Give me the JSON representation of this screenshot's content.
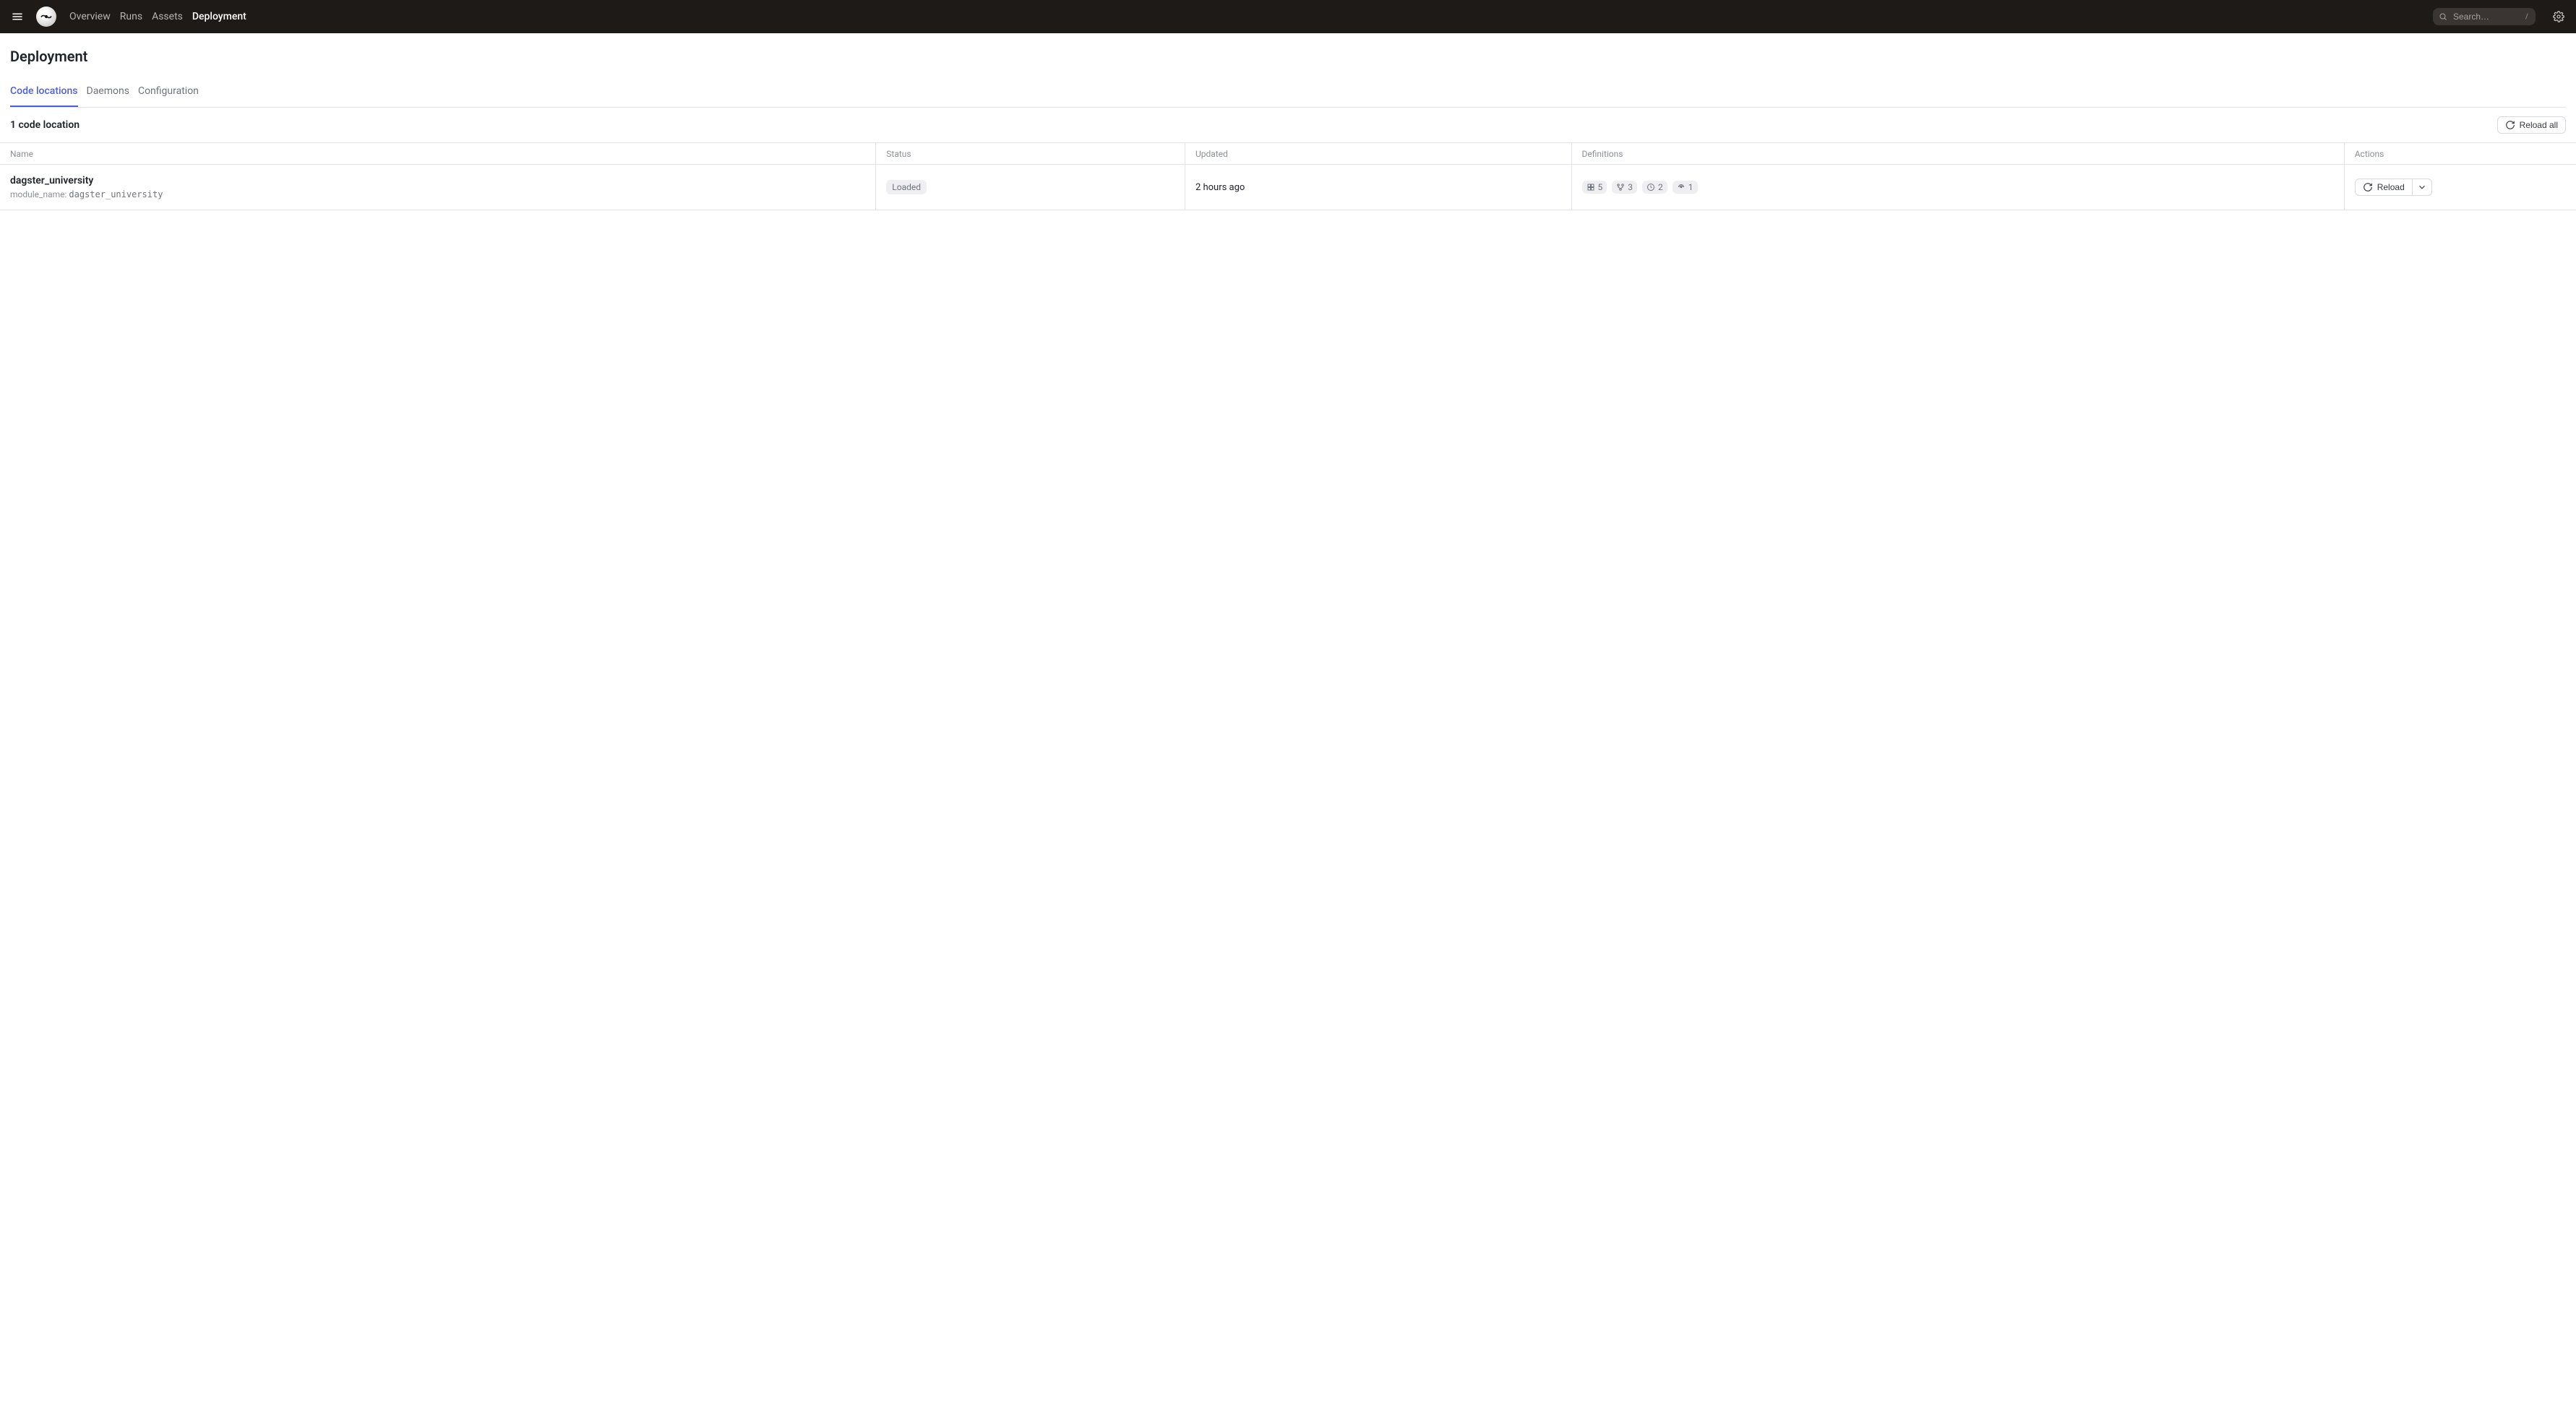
{
  "topbar": {
    "nav": [
      "Overview",
      "Runs",
      "Assets",
      "Deployment"
    ],
    "nav_active_index": 3,
    "search_placeholder": "Search…",
    "search_shortcut": "/"
  },
  "page": {
    "title": "Deployment"
  },
  "tabs": {
    "items": [
      "Code locations",
      "Daemons",
      "Configuration"
    ],
    "active_index": 0
  },
  "toolbar": {
    "count_text": "1 code location",
    "reload_all_label": "Reload all"
  },
  "table": {
    "columns": {
      "name": "Name",
      "status": "Status",
      "updated": "Updated",
      "definitions": "Definitions",
      "actions": "Actions"
    },
    "rows": [
      {
        "name": "dagster_university",
        "module_label": "module_name:",
        "module_value": "dagster_university",
        "status": "Loaded",
        "updated": "2 hours ago",
        "definitions": {
          "assets": "5",
          "jobs": "3",
          "schedules": "2",
          "sensors": "1"
        },
        "reload_label": "Reload"
      }
    ]
  }
}
